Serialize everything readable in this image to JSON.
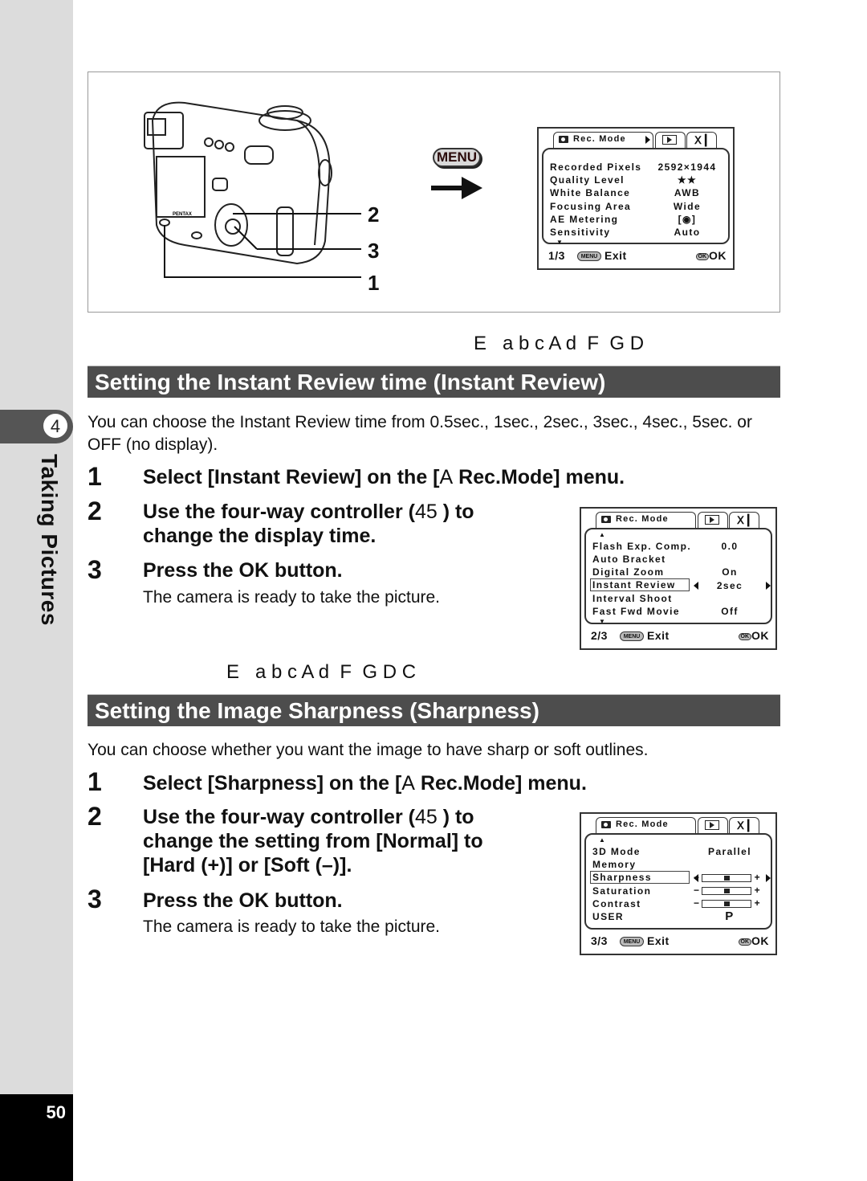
{
  "sidebar": {
    "chapter_number": "4",
    "chapter_title": "Taking Pictures",
    "page_number": "50"
  },
  "figure": {
    "callouts": [
      "2",
      "3",
      "1"
    ],
    "menu_button_label": "MENU",
    "camera_brand": "PENTAX",
    "lcd": {
      "tab_label": "Rec. Mode",
      "rows": [
        {
          "label": "Recorded Pixels",
          "value": "2592×1944"
        },
        {
          "label": "Quality Level",
          "value": "★★"
        },
        {
          "label": "White Balance",
          "value": "AWB"
        },
        {
          "label": "Focusing Area",
          "value": "Wide"
        },
        {
          "label": "AE Metering",
          "value": "[◉]"
        },
        {
          "label": "Sensitivity",
          "value": "Auto"
        }
      ],
      "page": "1/3",
      "menu_pill": "MENU",
      "exit_label": "Exit",
      "ok_pill": "OK",
      "ok_label": "OK"
    }
  },
  "section1": {
    "symbol_line": "E   a b c A d  F  G D",
    "title": "Setting the Instant Review time (Instant Review)",
    "intro": "You can choose the Instant Review time from 0.5sec., 1sec., 2sec., 3sec., 4sec., 5sec. or OFF (no display).",
    "steps": [
      {
        "num": "1",
        "text_a": "Select [Instant Review] on the [",
        "glyph": "A",
        "text_b": "  Rec.Mode] menu."
      },
      {
        "num": "2",
        "text_a": "Use the four-way controller (",
        "glyph": "45",
        "text_b": "   ) to",
        "line2": "change the display time."
      },
      {
        "num": "3",
        "text": "Press the OK button.",
        "note": "The camera is ready to take the picture."
      }
    ],
    "lcd": {
      "tab_label": "Rec. Mode",
      "rows": [
        {
          "label": "Flash Exp. Comp.",
          "value": "0.0"
        },
        {
          "label": "Auto Bracket",
          "value": ""
        },
        {
          "label": "Digital Zoom",
          "value": "On"
        },
        {
          "label": "Instant Review",
          "value": "2sec",
          "selected": true
        },
        {
          "label": "Interval Shoot",
          "value": ""
        },
        {
          "label": "Fast Fwd Movie",
          "value": "Off"
        }
      ],
      "page": "2/3",
      "menu_pill": "MENU",
      "exit_label": "Exit",
      "ok_pill": "OK",
      "ok_label": "OK"
    }
  },
  "section2": {
    "symbol_line": "E   a b c A d  F  G D C",
    "title": "Setting the Image Sharpness (Sharpness)",
    "intro": "You can choose whether you want the image to have sharp or soft outlines.",
    "steps": [
      {
        "num": "1",
        "text_a": "Select [Sharpness] on the [",
        "glyph": "A",
        "text_b": "  Rec.Mode] menu."
      },
      {
        "num": "2",
        "text_a": "Use the four-way controller (",
        "glyph": "45",
        "text_b": "   ) to",
        "line2": "change the setting from [Normal] to",
        "line3": "[Hard (+)] or [Soft (–)]."
      },
      {
        "num": "3",
        "text": "Press the OK button.",
        "note": "The camera is ready to take the picture."
      }
    ],
    "lcd": {
      "tab_label": "Rec. Mode",
      "rows": [
        {
          "label": "3D Mode",
          "value": "Parallel"
        },
        {
          "label": "Memory",
          "value": ""
        },
        {
          "label": "Sharpness",
          "slider_level": 0.5,
          "selected": true
        },
        {
          "label": "Saturation",
          "slider_level": 0.5
        },
        {
          "label": "Contrast",
          "slider_level": 0.5
        },
        {
          "label": "USER",
          "value": "P"
        }
      ],
      "slider_minus": "−",
      "slider_plus": "+",
      "page": "3/3",
      "menu_pill": "MENU",
      "exit_label": "Exit",
      "ok_pill": "OK",
      "ok_label": "OK"
    }
  }
}
